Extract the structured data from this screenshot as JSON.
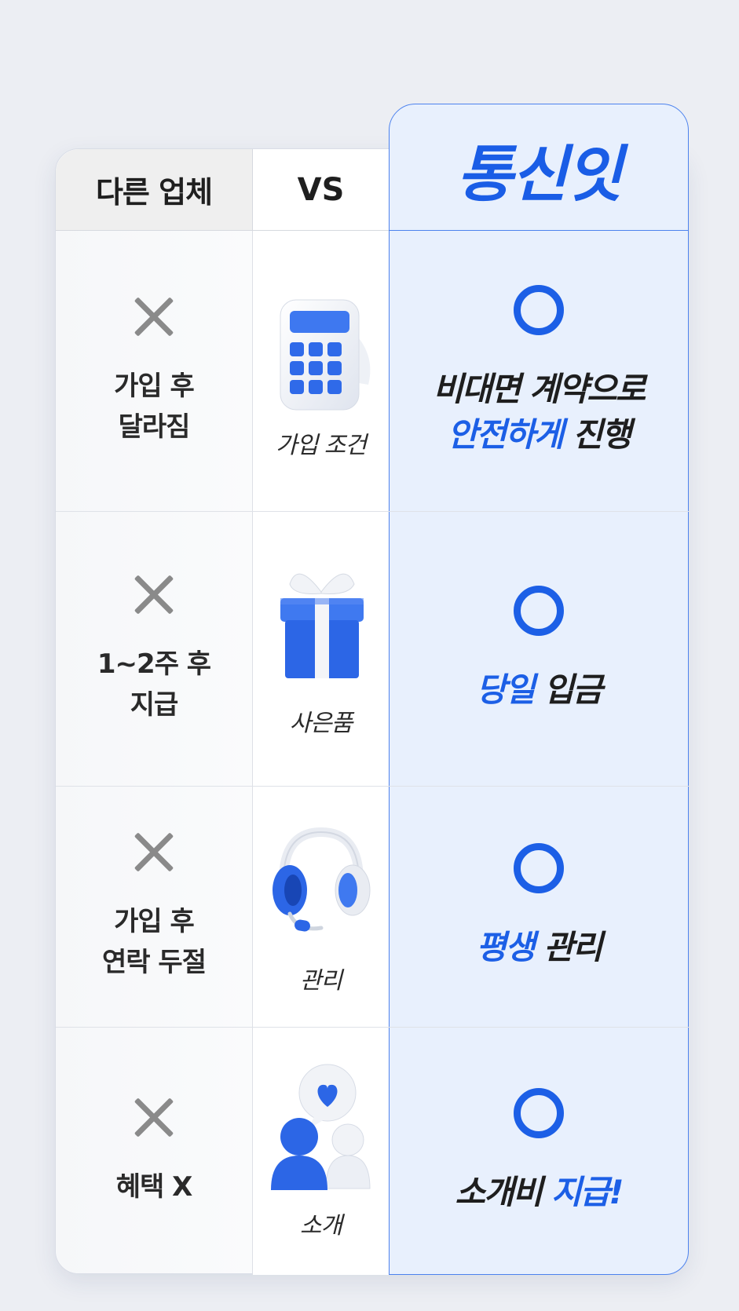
{
  "header": {
    "left": "다른 업체",
    "middle": "VS",
    "right": "통신잇"
  },
  "rows": [
    {
      "left_lines": [
        "가입 후",
        "달라짐"
      ],
      "middle_label": "가입 조건",
      "middle_icon": "calculator-icon",
      "right_lines": [
        [
          {
            "text": "비대면 계약으로",
            "blue": false
          }
        ],
        [
          {
            "text": "안전하게",
            "blue": true
          },
          {
            "text": " 진행",
            "blue": false
          }
        ]
      ]
    },
    {
      "left_lines": [
        "1~2주 후",
        "지급"
      ],
      "middle_label": "사은품",
      "middle_icon": "gift-box-icon",
      "right_lines": [
        [
          {
            "text": "당일",
            "blue": true
          },
          {
            "text": " 입금",
            "blue": false
          }
        ]
      ]
    },
    {
      "left_lines": [
        "가입 후",
        "연락 두절"
      ],
      "middle_label": "관리",
      "middle_icon": "headset-icon",
      "right_lines": [
        [
          {
            "text": "평생",
            "blue": true
          },
          {
            "text": " 관리",
            "blue": false
          }
        ]
      ]
    },
    {
      "left_lines": [
        "혜택 X"
      ],
      "middle_label": "소개",
      "middle_icon": "referral-people-icon",
      "right_lines": [
        [
          {
            "text": "소개비",
            "blue": false
          },
          {
            "text": " 지급!",
            "blue": true
          }
        ]
      ]
    }
  ],
  "colors": {
    "accent_blue": "#1c5fe6",
    "right_column_bg": "#e8f0fd",
    "x_mark_gray": "#8a8a8a"
  }
}
